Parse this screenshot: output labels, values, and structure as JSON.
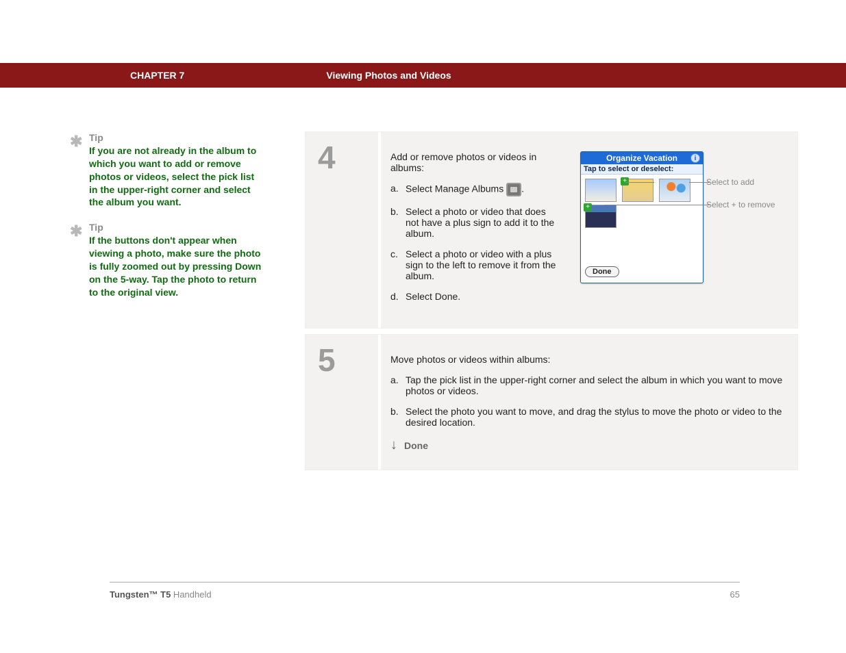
{
  "header": {
    "chapter": "CHAPTER 7",
    "title": "Viewing Photos and Videos"
  },
  "sidebar": {
    "tips": [
      {
        "head": "Tip",
        "body": "If you are not already in the album to which you want to add or remove photos or videos, select the pick list in the upper-right corner and select the album you want."
      },
      {
        "head": "Tip",
        "body": "If the buttons don't appear when viewing a photo, make sure the photo is fully zoomed out by pressing Down on the 5-way. Tap the photo to return to the original view."
      }
    ]
  },
  "steps": {
    "s4": {
      "num": "4",
      "intro": "Add or remove photos or videos in albums:",
      "items": [
        {
          "m": "a.",
          "t_pre": "Select Manage Albums ",
          "t_post": "."
        },
        {
          "m": "b.",
          "t": "Select a photo or video that does not have a plus sign to add it to the album."
        },
        {
          "m": "c.",
          "t": "Select a photo or video with a plus sign to the left to remove it from the album."
        },
        {
          "m": "d.",
          "t": "Select Done."
        }
      ],
      "shot": {
        "title": "Organize Vacation",
        "sub": "Tap to select or deselect:",
        "label_add": "Select to add",
        "label_remove": "Select + to remove",
        "done": "Done",
        "plus": "+"
      }
    },
    "s5": {
      "num": "5",
      "intro": "Move photos or videos within albums:",
      "items": [
        {
          "m": "a.",
          "t": "Tap the pick list in the upper-right corner and select the album in which you want to move photos or videos."
        },
        {
          "m": "b.",
          "t": "Select the photo you want to move, and drag the stylus to move the photo or video to the desired location."
        }
      ],
      "done": "Done"
    }
  },
  "footer": {
    "product_bold": "Tungsten™ T5",
    "product_rest": " Handheld",
    "page": "65"
  }
}
